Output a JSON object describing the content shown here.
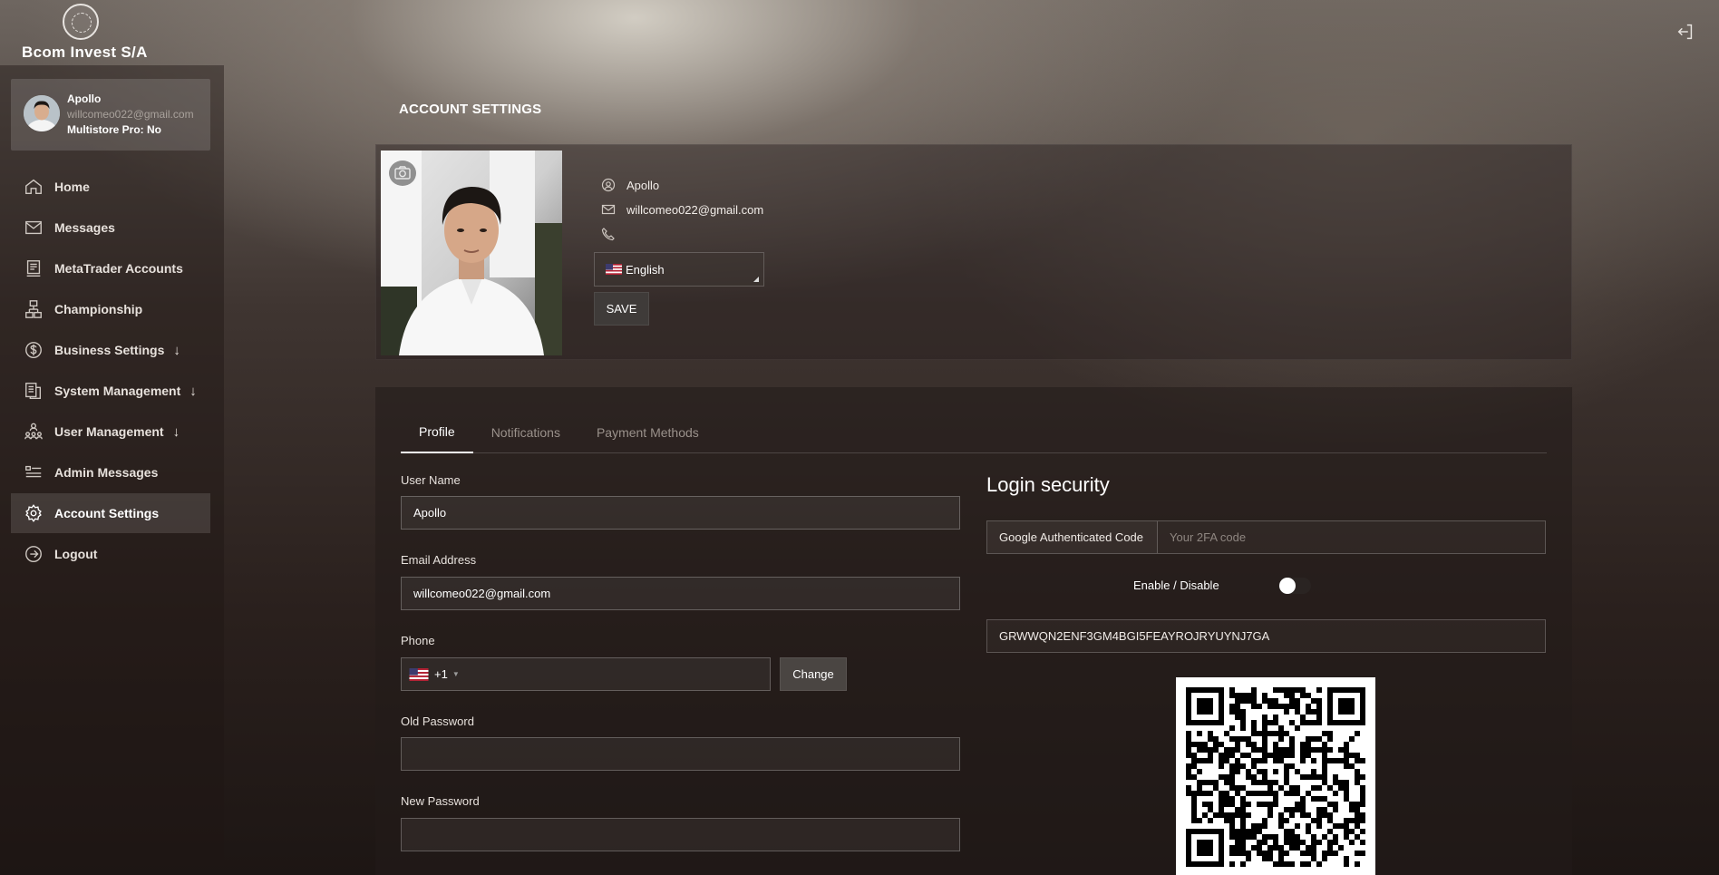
{
  "app": {
    "brand": "Bcom Invest S/A"
  },
  "user": {
    "name": "Apollo",
    "email": "willcomeo022@gmail.com",
    "multistore": "Multistore Pro: No"
  },
  "sidebar": {
    "items": [
      {
        "label": "Home",
        "icon": "home-icon"
      },
      {
        "label": "Messages",
        "icon": "mail-icon"
      },
      {
        "label": "MetaTrader Accounts",
        "icon": "document-icon"
      },
      {
        "label": "Championship",
        "icon": "hierarchy-icon"
      },
      {
        "label": "Business Settings",
        "icon": "dollar-icon",
        "arrow": "↓"
      },
      {
        "label": "System Management",
        "icon": "server-icon",
        "arrow": "↓"
      },
      {
        "label": "User Management",
        "icon": "users-icon",
        "arrow": "↓"
      },
      {
        "label": "Admin Messages",
        "icon": "list-icon"
      },
      {
        "label": "Account Settings",
        "icon": "gear-icon",
        "active": true
      },
      {
        "label": "Logout",
        "icon": "logout-icon"
      }
    ]
  },
  "page": {
    "title": "ACCOUNT SETTINGS"
  },
  "profile_card": {
    "name": "Apollo",
    "email": "willcomeo022@gmail.com",
    "phone": "",
    "language": "English",
    "save_label": "SAVE"
  },
  "tabs": [
    {
      "label": "Profile",
      "active": true
    },
    {
      "label": "Notifications",
      "active": false
    },
    {
      "label": "Payment Methods",
      "active": false
    }
  ],
  "form": {
    "username_label": "User Name",
    "username_value": "Apollo",
    "email_label": "Email Address",
    "email_value": "willcomeo022@gmail.com",
    "phone_label": "Phone",
    "phone_code": "+1",
    "phone_value": "",
    "change_label": "Change",
    "old_password_label": "Old Password",
    "new_password_label": "New Password"
  },
  "security": {
    "title": "Login security",
    "ga_label": "Google Authenticated Code",
    "ga_placeholder": "Your 2FA code",
    "toggle_label": "Enable / Disable",
    "toggle_on": false,
    "secret": "GRWWQN2ENF3GM4BGI5FEAYROJRYUYNJ7GA"
  },
  "colors": {
    "accent_white": "#ffffff",
    "muted_text": "#9a918b"
  }
}
